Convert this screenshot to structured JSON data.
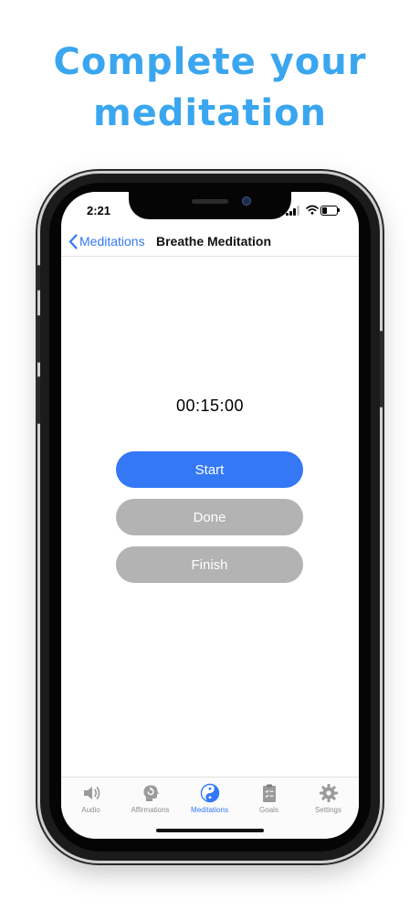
{
  "promo": {
    "line1": "Complete your",
    "line2": "meditation"
  },
  "status_bar": {
    "time": "2:21"
  },
  "nav": {
    "back_label": "Meditations",
    "title": "Breathe Meditation"
  },
  "timer": {
    "value": "00:15:00"
  },
  "buttons": {
    "start": "Start",
    "done": "Done",
    "finish": "Finish"
  },
  "tabs": [
    {
      "label": "Audio",
      "icon": "speaker-icon"
    },
    {
      "label": "Affirmations",
      "icon": "head-refresh-icon"
    },
    {
      "label": "Meditations",
      "icon": "yin-yang-icon",
      "active": true
    },
    {
      "label": "Goals",
      "icon": "clipboard-icon"
    },
    {
      "label": "Settings",
      "icon": "gear-icon"
    }
  ],
  "colors": {
    "headline": "#3aa6ef",
    "accent": "#3478f6",
    "disabled_button": "#b3b3b3",
    "inactive_tab": "#8e8e8e"
  }
}
